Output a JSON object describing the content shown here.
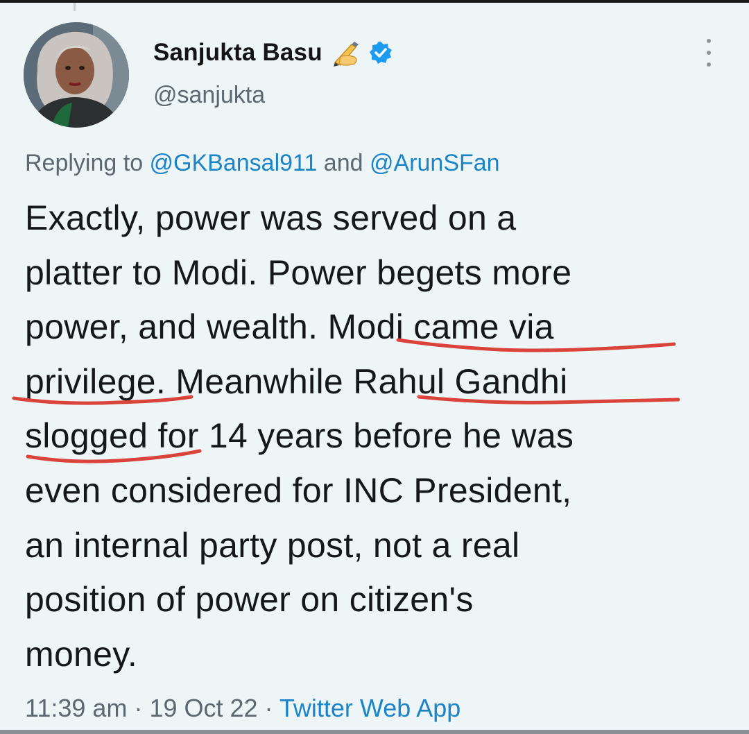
{
  "author": {
    "name": "Sanjukta Basu",
    "handle": "@sanjukta",
    "pen_icon": "writing-hand-emoji",
    "verified_icon": "verified-badge",
    "verified_color": "#1d9bf0"
  },
  "reply": {
    "prefix": "Replying to ",
    "mention1": "@GKBansal911",
    "joiner": " and ",
    "mention2": "@ArunSFan"
  },
  "tweet": {
    "lines": [
      "Exactly, power was served on a",
      "platter to Modi. Power begets more",
      "power, and wealth. Modi came via",
      "privilege. Meanwhile Rahul Gandhi",
      "slogged for 14 years before he was",
      "even considered for INC President,",
      "an internal party post, not a real",
      "position of power on citizen's",
      "money."
    ],
    "underlined_phrases": [
      "Modi came via",
      "privilege.",
      "Rahul Gandhi",
      "slogged for"
    ],
    "underline_color": "#d9433a"
  },
  "meta": {
    "time": "11:39 am",
    "sep1": " · ",
    "date": "19 Oct 22",
    "sep2": " · ",
    "source": "Twitter Web App"
  },
  "colors": {
    "background": "#eef5f7",
    "text": "#15181b",
    "secondary": "#5c6870",
    "link": "#1b84c9"
  }
}
